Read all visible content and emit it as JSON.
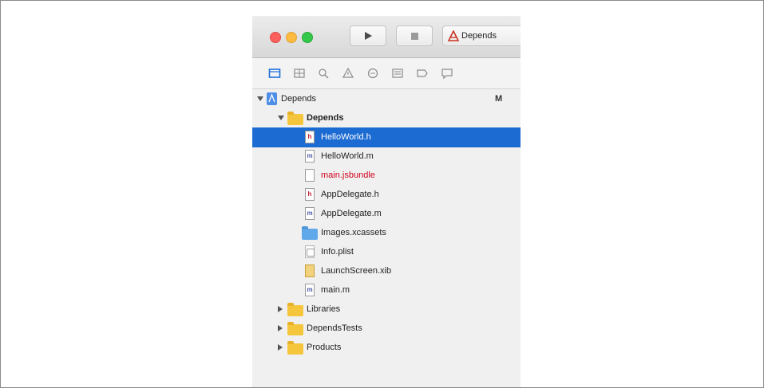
{
  "toolbar": {
    "scheme_label": "Depends",
    "icons": {
      "run": "play-icon",
      "stop": "stop-icon",
      "scheme": "xcode-app-icon"
    }
  },
  "navigator_bar": {
    "icons": [
      "folder-navigator-icon",
      "source-control-navigator-icon",
      "find-navigator-icon",
      "issue-navigator-icon",
      "test-navigator-icon",
      "debug-navigator-icon",
      "breakpoint-navigator-icon",
      "report-navigator-icon"
    ]
  },
  "tree": {
    "project": {
      "label": "Depends",
      "badge": "M"
    },
    "group": {
      "label": "Depends"
    },
    "files": [
      {
        "label": "HelloWorld.h",
        "glyph": "h",
        "selected": true
      },
      {
        "label": "HelloWorld.m",
        "glyph": "m"
      },
      {
        "label": "main.jsbundle",
        "missing": true
      },
      {
        "label": "AppDelegate.h",
        "glyph": "h"
      },
      {
        "label": "AppDelegate.m",
        "glyph": "m"
      },
      {
        "label": "Images.xcassets"
      },
      {
        "label": "Info.plist"
      },
      {
        "label": "LaunchScreen.xib"
      },
      {
        "label": "main.m",
        "glyph": "m"
      }
    ],
    "groups": [
      {
        "label": "Libraries"
      },
      {
        "label": "DependsTests"
      },
      {
        "label": "Products"
      }
    ]
  },
  "colors": {
    "selection": "#1c6bd3",
    "missing_file": "#d0021b",
    "folder": "#f5c63c"
  }
}
